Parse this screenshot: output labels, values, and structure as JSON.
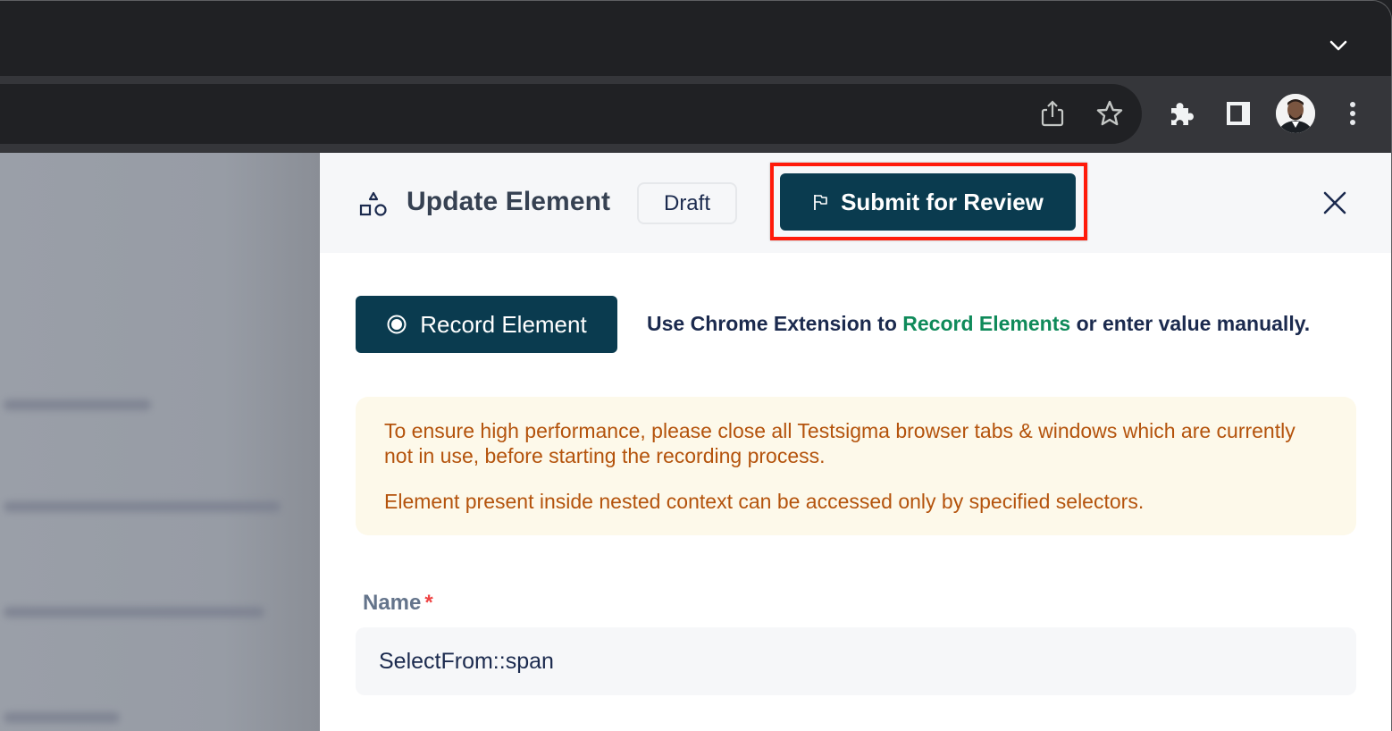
{
  "browser": {
    "tab_search_icon": "chevron-down-icon",
    "toolbar_icons": [
      "share-icon",
      "bookmark-star-icon",
      "extensions-puzzle-icon",
      "side-panel-icon",
      "profile-avatar",
      "more-vertical-icon"
    ]
  },
  "drawer": {
    "icon": "shapes-icon",
    "title": "Update Element",
    "status_badge": "Draft",
    "submit_button": {
      "icon": "flag-icon",
      "label": "Submit for Review"
    },
    "close_icon": "close-icon",
    "highlight_color": "#ff1a0a"
  },
  "record": {
    "button_icon": "record-icon",
    "button_label": "Record Element",
    "helper_prefix": "Use Chrome Extension to ",
    "helper_link": "Record Elements",
    "helper_suffix": " or enter value manually."
  },
  "warning": {
    "line1": "To ensure high performance, please close all Testsigma browser tabs & windows which are currently not in use, before starting the recording process.",
    "line2": "Element present inside nested context can be accessed only by specified selectors."
  },
  "form": {
    "name_label": "Name",
    "name_required_marker": "*",
    "name_value": "SelectFrom::span"
  },
  "colors": {
    "primary": "#0a3b4f",
    "link_green": "#0f8a5a",
    "warning_text": "#b4530c",
    "warning_bg": "#fdf9ea"
  }
}
